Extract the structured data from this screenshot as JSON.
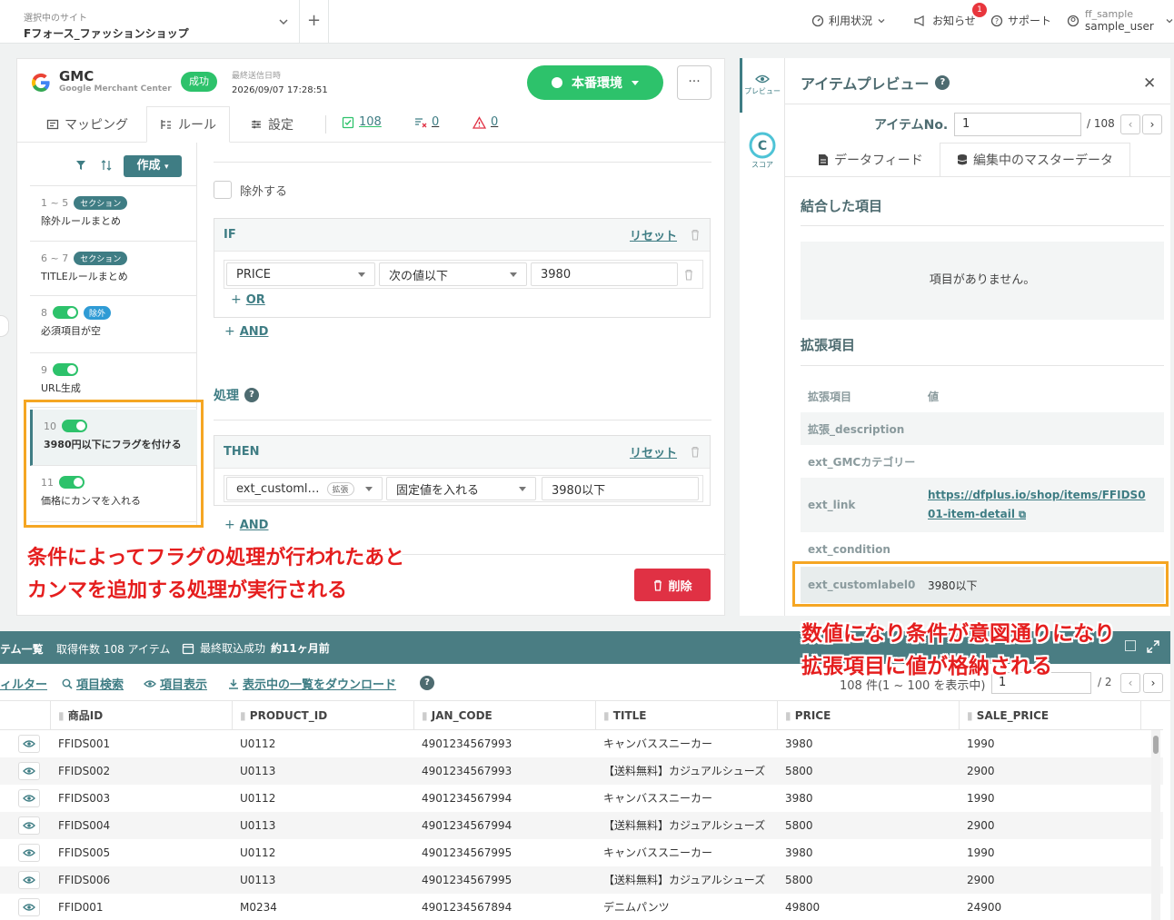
{
  "topbar": {
    "site_label": "選択中のサイト",
    "site_name": "Fフォース_ファッションショップ",
    "usage": "利用状況",
    "notices": "お知らせ",
    "notice_count": "1",
    "support": "サポート",
    "user_id": "ff_sample",
    "user_name": "sample_user"
  },
  "gmc": {
    "name": "GMC",
    "subtitle": "Google Merchant Center",
    "status": "成功",
    "last_sent_label": "最終送信日時",
    "last_sent_value": "2026/09/07 17:28:51",
    "env_button": "本番環境",
    "more": "···"
  },
  "tabs": {
    "mapping": "マッピング",
    "rules": "ルール",
    "settings": "設定",
    "count_ok": "108",
    "count_x": "0",
    "count_warn": "0"
  },
  "rule_list": {
    "create": "作成",
    "items": [
      {
        "num": "1 ~ 5",
        "tag": "セクション",
        "name": "除外ルールまとめ"
      },
      {
        "num": "6 ~ 7",
        "tag": "セクション",
        "name": "TITLEルールまとめ"
      },
      {
        "num": "8",
        "tag": "除外",
        "name": "必須項目が空"
      },
      {
        "num": "9",
        "name": "URL生成"
      },
      {
        "num": "10",
        "name": "3980円以下にフラグを付ける"
      },
      {
        "num": "11",
        "name": "価格にカンマを入れる"
      }
    ]
  },
  "editor": {
    "exclude_label": "除外する",
    "if_label": "IF",
    "reset": "リセット",
    "if_field": "PRICE",
    "if_op": "次の値以下",
    "if_value": "3980",
    "or_link": "OR",
    "and_link": "AND",
    "process_title": "処理",
    "then_label": "THEN",
    "then_field": "ext_customl…",
    "then_field_tag": "拡張",
    "then_op": "固定値を入れる",
    "then_value": "3980以下",
    "delete": "削除"
  },
  "annotations": {
    "left_line1": "条件によってフラグの処理が行われたあと",
    "left_line2": "カンマを追加する処理が実行される",
    "right_line1": "数値になり条件が意図通りになり",
    "right_line2": "拡張項目に値が格納される"
  },
  "rail": {
    "preview": "プレビュー",
    "score": "スコア"
  },
  "preview": {
    "title": "アイテムプレビュー",
    "item_no_label": "アイテムNo.",
    "item_no_value": "1",
    "item_total": "/ 108",
    "tab_feed": "データフィード",
    "tab_master": "編集中のマスターデータ",
    "joined_title": "結合した項目",
    "no_items": "項目がありません。",
    "ext_title": "拡張項目",
    "ext_head_key": "拡張項目",
    "ext_head_val": "値",
    "ext_rows": [
      {
        "k": "拡張_description",
        "v": ""
      },
      {
        "k": "ext_GMCカテゴリー",
        "v": ""
      },
      {
        "k": "ext_link",
        "v1": "https://dfplus.io/shop/items/FFIDS0",
        "v2": "01-item-detail"
      },
      {
        "k": "ext_condition",
        "v": ""
      },
      {
        "k": "ext_customlabel0",
        "v": "3980以下"
      }
    ]
  },
  "item_list": {
    "title": "テム一覧",
    "count": "取得件数 108 アイテム",
    "last_import_label": "最終取込成功",
    "last_import_value": "約11ヶ月前",
    "filter": "ィルター",
    "search": "項目検索",
    "display": "項目表示",
    "download": "表示中の一覧をダウンロード",
    "range": "108 件(1 ~ 100 を表示中)",
    "page_value": "1",
    "page_total": "/ 2",
    "columns": [
      "商品ID",
      "PRODUCT_ID",
      "JAN_CODE",
      "TITLE",
      "PRICE",
      "SALE_PRICE"
    ],
    "rows": [
      [
        "FFIDS001",
        "U0112",
        "4901234567993",
        "キャンバススニーカー",
        "3980",
        "1990"
      ],
      [
        "FFIDS002",
        "U0113",
        "4901234567993",
        "【送料無料】カジュアルシューズ",
        "5800",
        "2900"
      ],
      [
        "FFIDS003",
        "U0112",
        "4901234567994",
        "キャンバススニーカー",
        "3980",
        "1990"
      ],
      [
        "FFIDS004",
        "U0113",
        "4901234567994",
        "【送料無料】カジュアルシューズ",
        "5800",
        "2900"
      ],
      [
        "FFIDS005",
        "U0112",
        "4901234567995",
        "キャンバススニーカー",
        "3980",
        "1990"
      ],
      [
        "FFIDS006",
        "U0113",
        "4901234567995",
        "【送料無料】カジュアルシューズ",
        "5800",
        "2900"
      ],
      [
        "FFID001",
        "M0234",
        "4901234567894",
        "デニムパンツ",
        "49800",
        "24900"
      ]
    ]
  }
}
